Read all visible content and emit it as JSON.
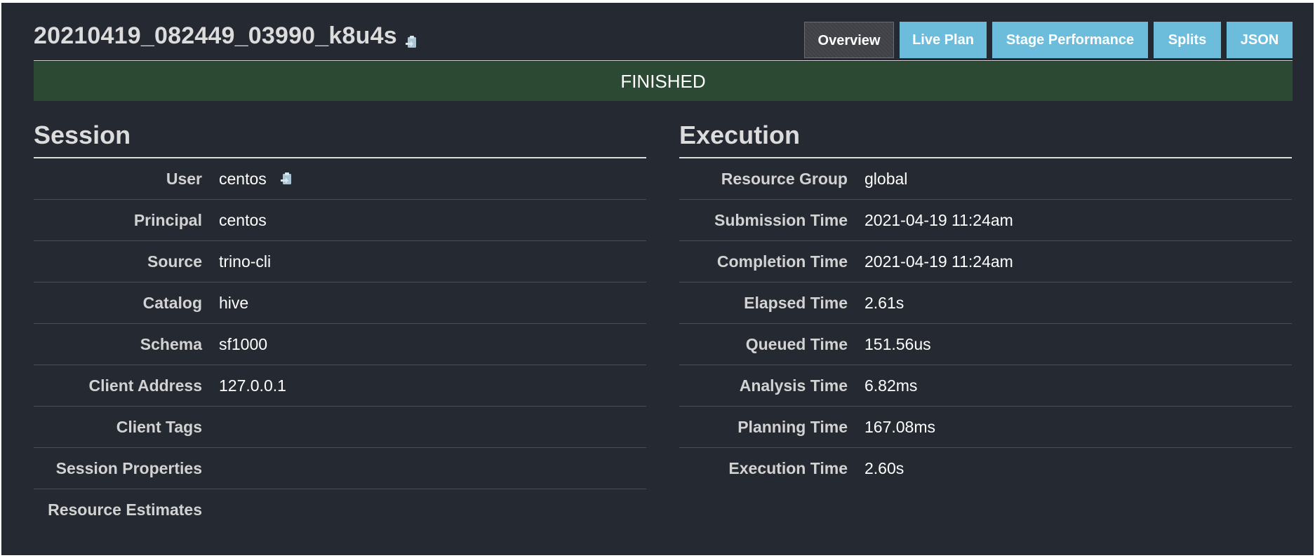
{
  "query": {
    "id": "20210419_082449_03990_k8u4s"
  },
  "tabs": [
    {
      "label": "Overview",
      "active": true
    },
    {
      "label": "Live Plan",
      "active": false
    },
    {
      "label": "Stage Performance",
      "active": false
    },
    {
      "label": "Splits",
      "active": false
    },
    {
      "label": "JSON",
      "active": false
    }
  ],
  "state": {
    "label": "FINISHED",
    "color": "#2c4a33"
  },
  "session": {
    "title": "Session",
    "rows": [
      {
        "label": "User",
        "value": "centos"
      },
      {
        "label": "Principal",
        "value": "centos"
      },
      {
        "label": "Source",
        "value": "trino-cli"
      },
      {
        "label": "Catalog",
        "value": "hive"
      },
      {
        "label": "Schema",
        "value": "sf1000"
      },
      {
        "label": "Client Address",
        "value": "127.0.0.1"
      },
      {
        "label": "Client Tags",
        "value": ""
      },
      {
        "label": "Session Properties",
        "value": ""
      },
      {
        "label": "Resource Estimates",
        "value": ""
      }
    ]
  },
  "execution": {
    "title": "Execution",
    "rows": [
      {
        "label": "Resource Group",
        "value": "global"
      },
      {
        "label": "Submission Time",
        "value": "2021-04-19 11:24am"
      },
      {
        "label": "Completion Time",
        "value": "2021-04-19 11:24am"
      },
      {
        "label": "Elapsed Time",
        "value": "2.61s"
      },
      {
        "label": "Queued Time",
        "value": "151.56us"
      },
      {
        "label": "Analysis Time",
        "value": "6.82ms"
      },
      {
        "label": "Planning Time",
        "value": "167.08ms"
      },
      {
        "label": "Execution Time",
        "value": "2.60s"
      }
    ]
  },
  "icons": {
    "copy": "clipboard-icon"
  },
  "colors": {
    "background": "#252931",
    "tab": "#6cbcdc",
    "tab_active": "#404247",
    "finished": "#2c4a33"
  }
}
